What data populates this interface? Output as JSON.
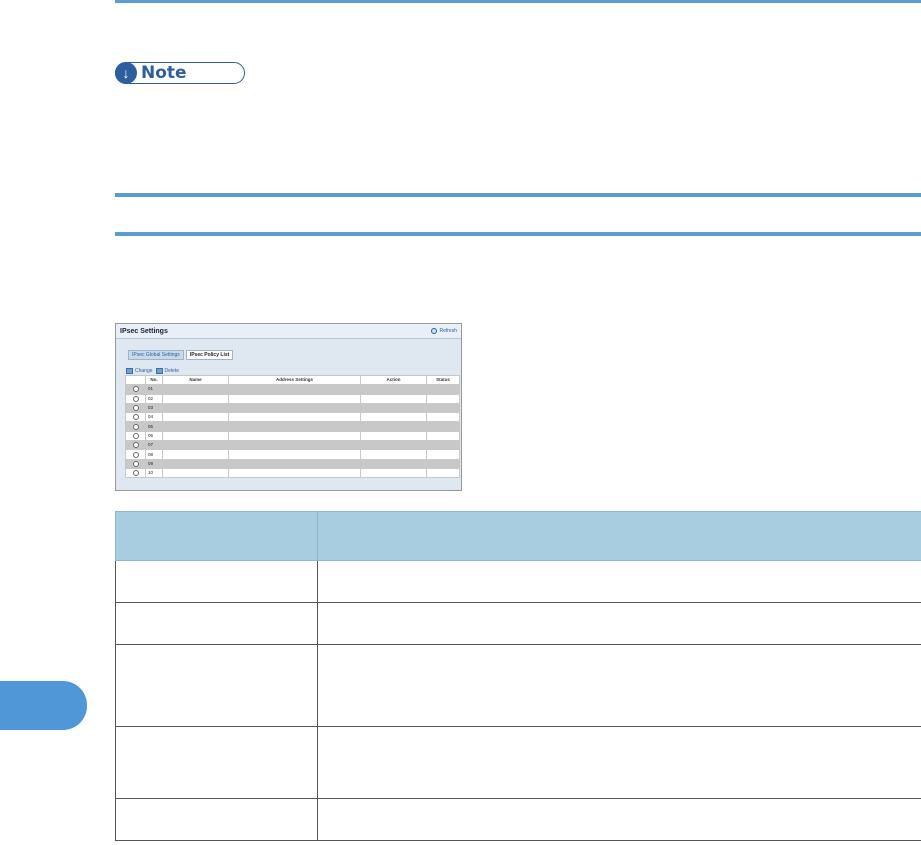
{
  "note": {
    "label": "Note",
    "icon": "down-arrow-icon"
  },
  "screenshot": {
    "title": "IPsec Settings",
    "refresh_label": "Refresh",
    "tabs": [
      {
        "label": "IPsec Global Settings"
      },
      {
        "label": "IPsec Policy List"
      }
    ],
    "toolbar": {
      "change_label": "Change",
      "delete_label": "Delete"
    },
    "columns": [
      "No.",
      "Name",
      "Address Settings",
      "Action",
      "Status"
    ],
    "rows": [
      {
        "no": "01"
      },
      {
        "no": "02"
      },
      {
        "no": "03"
      },
      {
        "no": "04"
      },
      {
        "no": "05"
      },
      {
        "no": "06"
      },
      {
        "no": "07"
      },
      {
        "no": "08"
      },
      {
        "no": "09"
      },
      {
        "no": "10"
      }
    ]
  },
  "colors": {
    "accent": "#5a9bd0",
    "table_header": "#a8cde1",
    "side_tab": "#4f97d6"
  }
}
